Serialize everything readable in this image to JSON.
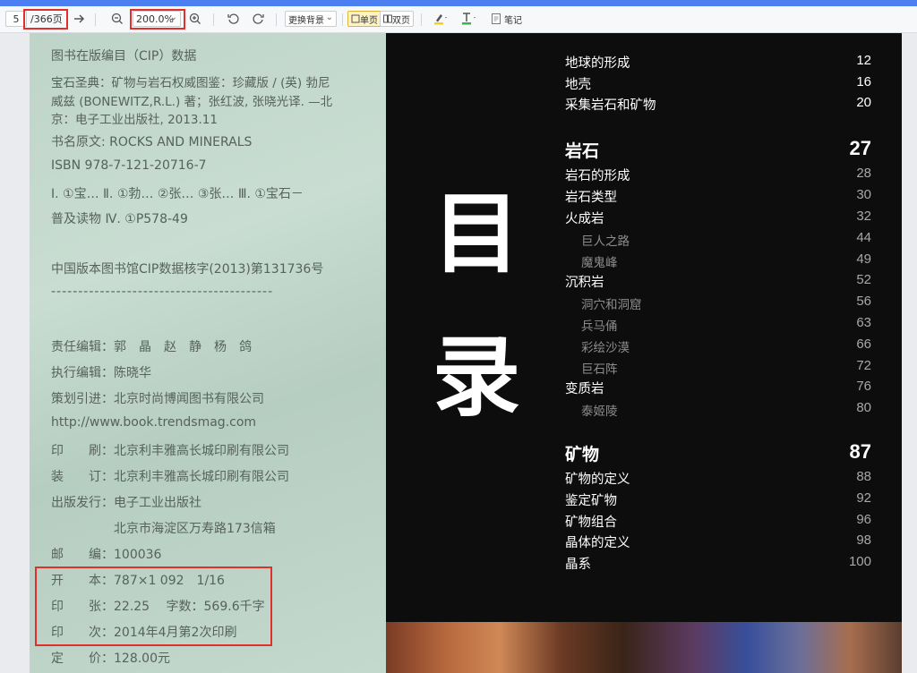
{
  "toolbar": {
    "page_current": "5",
    "page_total": "/366页",
    "zoom_value": "200.0%",
    "change_bg_label": "更换背景",
    "single_page_label": "单页",
    "double_page_label": "双页",
    "notes_label": "笔记"
  },
  "left_page": {
    "lines": [
      "图书在版编目（CIP）数据",
      "宝石圣典：矿物与岩石权威图鉴：珍藏版 / (英) 勃尼",
      "威兹 (BONEWITZ,R.L.) 著；张红波, 张晓光译. —北",
      "京：电子工业出版社, 2013.11",
      "书名原文: ROCKS AND MINERALS",
      "ISBN 978-7-121-20716-7",
      "Ⅰ. ①宝… Ⅱ. ①勃… ②张… ③张… Ⅲ. ①宝石－",
      "普及读物 Ⅳ. ①P578-49",
      "中国版本图书馆CIP数据核字(2013)第131736号",
      "-----------------------------------------",
      "责任编辑：郭　晶　赵　静　杨　鸽",
      "执行编辑：陈晓华",
      "策划引进：北京时尚博闻图书有限公司",
      "http://www.book.trendsmag.com",
      "印　　刷：北京利丰雅高长城印刷有限公司",
      "装　　订：北京利丰雅高长城印刷有限公司",
      "出版发行：电子工业出版社",
      "　　　　　北京市海淀区万寿路173信箱",
      "邮　　编：100036",
      "开　　本：787×1 092　1/16",
      "印　　张：22.25　 字数：569.6千字",
      "印　　次：2014年4月第2次印刷",
      "定　　价：128.00元"
    ]
  },
  "right_page": {
    "big_title_1": "目",
    "big_title_2": "录",
    "toc": [
      {
        "title": "地球的形成",
        "page": "12"
      },
      {
        "title": "地壳",
        "page": "16"
      },
      {
        "title": "采集岩石和矿物",
        "page": "20"
      },
      {
        "title": "岩石",
        "page": "27"
      },
      {
        "title": "岩石的形成",
        "page": "28"
      },
      {
        "title": "岩石类型",
        "page": "30"
      },
      {
        "title": "火成岩",
        "page": "32"
      },
      {
        "title": "巨人之路",
        "page": "44"
      },
      {
        "title": "魔鬼峰",
        "page": "49"
      },
      {
        "title": "沉积岩",
        "page": "52"
      },
      {
        "title": "洞穴和洞窟",
        "page": "56"
      },
      {
        "title": "兵马俑",
        "page": "63"
      },
      {
        "title": "彩绘沙漠",
        "page": "66"
      },
      {
        "title": "巨石阵",
        "page": "72"
      },
      {
        "title": "变质岩",
        "page": "76"
      },
      {
        "title": "泰姬陵",
        "page": "80"
      },
      {
        "title": "矿物",
        "page": "87"
      },
      {
        "title": "矿物的定义",
        "page": "88"
      },
      {
        "title": "鉴定矿物",
        "page": "92"
      },
      {
        "title": "矿物组合",
        "page": "96"
      },
      {
        "title": "晶体的定义",
        "page": "98"
      },
      {
        "title": "晶系",
        "page": "100"
      }
    ]
  },
  "colors": {
    "accent": "#4b7ff2",
    "highlight_box": "#e0302b",
    "toc_background": "#0d0d0d"
  }
}
